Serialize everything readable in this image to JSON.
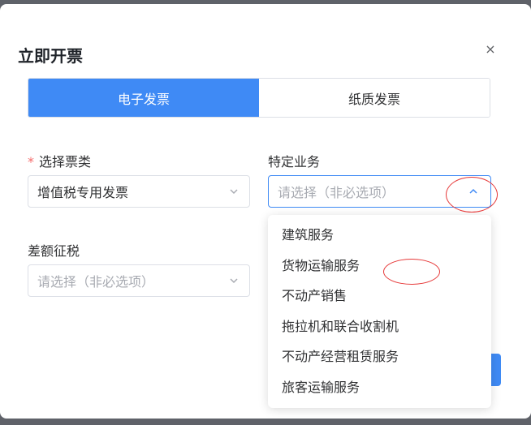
{
  "dialog": {
    "title": "立即开票",
    "close_glyph": "×"
  },
  "tabs": [
    {
      "label": "电子发票",
      "active": true
    },
    {
      "label": "纸质发票",
      "active": false
    }
  ],
  "form": {
    "ticket_type": {
      "label": "选择票类",
      "required_mark": "*",
      "value": "增值税专用发票"
    },
    "special_business": {
      "label": "特定业务",
      "placeholder": "请选择（非必选项）",
      "open": true
    },
    "difference_tax": {
      "label": "差额征税",
      "placeholder": "请选择（非必选项）"
    }
  },
  "dropdown": {
    "options": [
      "建筑服务",
      "货物运输服务",
      "不动产销售",
      "拖拉机和联合收割机",
      "不动产经营租赁服务",
      "旅客运输服务"
    ]
  },
  "colors": {
    "primary": "#3f8af5",
    "required": "#f56c6c",
    "annotation": "#e63838"
  },
  "icons": {
    "close": "close-icon",
    "chevron_down": "chevron-down-icon",
    "chevron_up": "chevron-up-icon"
  }
}
